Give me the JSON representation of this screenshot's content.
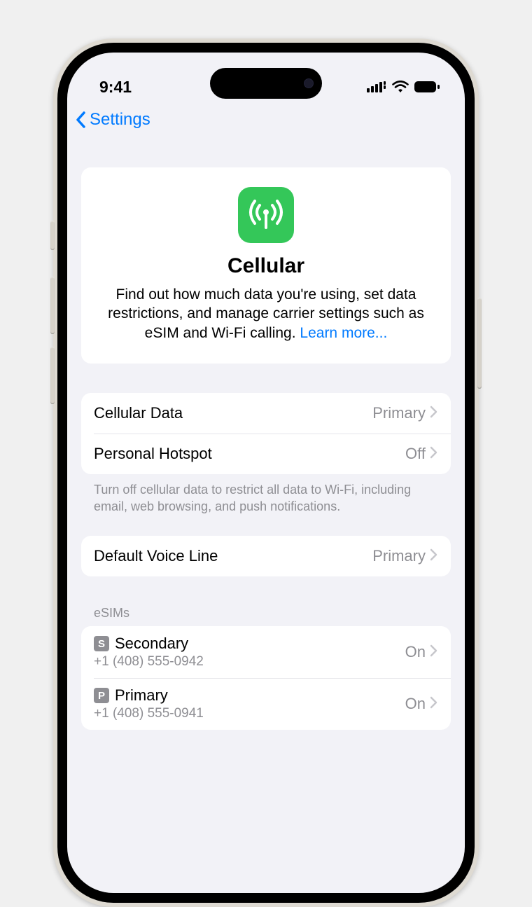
{
  "status": {
    "time": "9:41"
  },
  "nav": {
    "back_label": "Settings"
  },
  "hero": {
    "title": "Cellular",
    "description": "Find out how much data you're using, set data restrictions, and manage carrier settings such as eSIM and Wi-Fi calling. ",
    "learn_more": "Learn more..."
  },
  "data_group": {
    "rows": [
      {
        "label": "Cellular Data",
        "value": "Primary"
      },
      {
        "label": "Personal Hotspot",
        "value": "Off"
      }
    ],
    "footer": "Turn off cellular data to restrict all data to Wi-Fi, including email, web browsing, and push notifications."
  },
  "voice_group": {
    "rows": [
      {
        "label": "Default Voice Line",
        "value": "Primary"
      }
    ]
  },
  "esim": {
    "header": "eSIMs",
    "lines": [
      {
        "badge": "S",
        "name": "Secondary",
        "number": "+1 (408) 555-0942",
        "status": "On"
      },
      {
        "badge": "P",
        "name": "Primary",
        "number": "+1 (408) 555-0941",
        "status": "On"
      }
    ]
  },
  "colors": {
    "tint": "#007aff",
    "green": "#34c759",
    "gray_text": "#8e8e93",
    "bg": "#f2f2f7"
  }
}
